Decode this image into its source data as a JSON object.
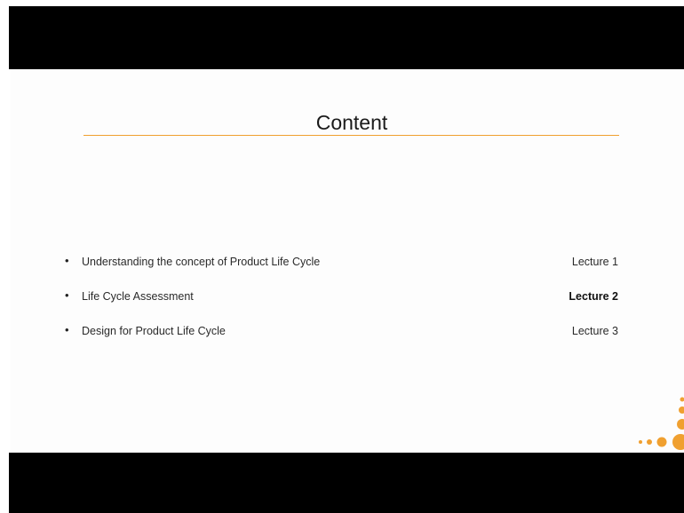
{
  "slide": {
    "title": "Content",
    "accent_color": "#f0a030",
    "items": [
      {
        "text": "Understanding the concept of Product Life Cycle",
        "lecture": "Lecture 1",
        "current": false
      },
      {
        "text": "Life Cycle Assessment",
        "lecture": "Lecture 2",
        "current": true
      },
      {
        "text": "Design for Product Life Cycle",
        "lecture": "Lecture 3",
        "current": false
      }
    ],
    "decoration_icon": "orange-dots-icon"
  }
}
